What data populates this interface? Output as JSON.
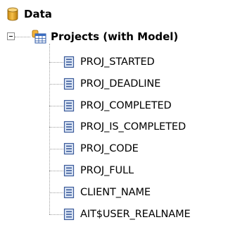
{
  "tree": {
    "root": {
      "label": "Data",
      "icon": "database-icon",
      "icon_color": "#e0a020"
    },
    "model": {
      "label": "Projects (with Model)",
      "icon": "table-model-icon",
      "expanded": true
    },
    "fields": [
      {
        "label": "PROJ_STARTED",
        "icon": "field-icon"
      },
      {
        "label": "PROJ_DEADLINE",
        "icon": "field-icon"
      },
      {
        "label": "PROJ_COMPLETED",
        "icon": "field-icon"
      },
      {
        "label": "PROJ_IS_COMPLETED",
        "icon": "field-icon"
      },
      {
        "label": "PROJ_CODE",
        "icon": "field-icon"
      },
      {
        "label": "PROJ_FULL",
        "icon": "field-icon"
      },
      {
        "label": "CLIENT_NAME",
        "icon": "field-icon"
      },
      {
        "label": "AIT$USER_REALNAME",
        "icon": "field-icon"
      }
    ],
    "colors": {
      "field_icon_border": "#3a5a9a",
      "field_icon_fill": "#dce6f5",
      "connector": "#a0a0a0"
    }
  }
}
